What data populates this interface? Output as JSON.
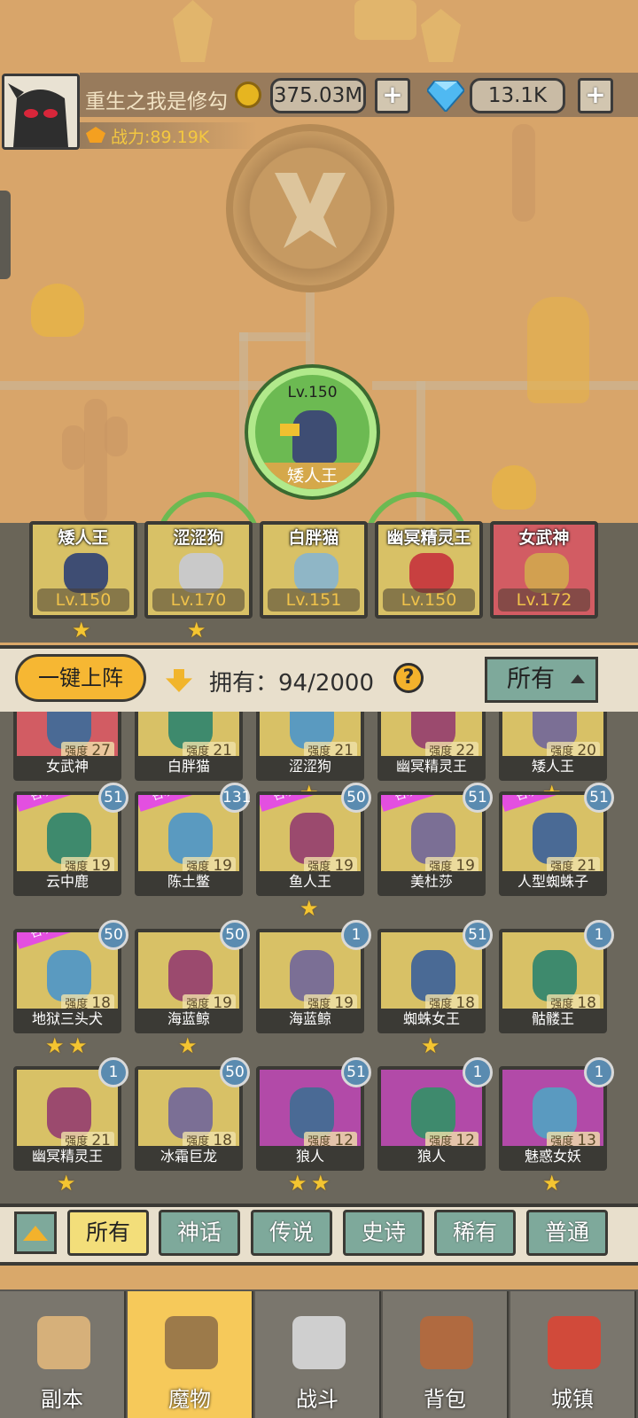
{
  "player": {
    "name": "重生之我是修勾",
    "power_label": "战力:89.19K"
  },
  "currency": {
    "gold": "375.03M",
    "diamond": "13.1K",
    "plus": "+"
  },
  "boss": {
    "level": "Lv.150",
    "name": "矮人王"
  },
  "team": [
    {
      "name": "矮人王",
      "level": "Lv.150",
      "color": "#d8c166",
      "stars": 1
    },
    {
      "name": "涩涩狗",
      "level": "Lv.170",
      "color": "#d8c166",
      "stars": 1
    },
    {
      "name": "白胖猫",
      "level": "Lv.151",
      "color": "#d8c166",
      "stars": 0
    },
    {
      "name": "幽冥精灵王",
      "level": "Lv.150",
      "color": "#d8c166",
      "stars": 0
    },
    {
      "name": "女武神",
      "level": "Lv.172",
      "color": "#d25c63",
      "stars": 0
    }
  ],
  "controls": {
    "auto_deploy": "一键上阵",
    "own_label": "拥有：94/2000",
    "help": "?",
    "filter": "所有"
  },
  "strength_label": "强度",
  "summoning_label": "召唤中",
  "cards_row0": [
    {
      "name": "女武神",
      "strength": "27"
    },
    {
      "name": "白胖猫",
      "strength": "21"
    },
    {
      "name": "涩涩狗",
      "strength": "21"
    },
    {
      "name": "幽冥精灵王",
      "strength": "22"
    },
    {
      "name": "矮人王",
      "strength": "20"
    }
  ],
  "cards_row1": [
    {
      "name": "云中鹿",
      "strength": "19",
      "badge": "51"
    },
    {
      "name": "陈土鳖",
      "strength": "19",
      "badge": "131"
    },
    {
      "name": "鱼人王",
      "strength": "19",
      "badge": "50"
    },
    {
      "name": "美杜莎",
      "strength": "19",
      "badge": "51"
    },
    {
      "name": "人型蜘蛛子",
      "strength": "21",
      "badge": "51"
    }
  ],
  "cards_row2": [
    {
      "name": "地狱三头犬",
      "strength": "18",
      "badge": "50"
    },
    {
      "name": "海蓝鲸",
      "strength": "19",
      "badge": "50"
    },
    {
      "name": "海蓝鲸",
      "strength": "19",
      "badge": "1"
    },
    {
      "name": "蜘蛛女王",
      "strength": "18",
      "badge": "51"
    },
    {
      "name": "骷髅王",
      "strength": "18",
      "badge": "1"
    }
  ],
  "cards_row3": [
    {
      "name": "幽冥精灵王",
      "strength": "21",
      "badge": "1"
    },
    {
      "name": "冰霜巨龙",
      "strength": "18",
      "badge": "50"
    },
    {
      "name": "狼人",
      "strength": "12",
      "badge": "51"
    },
    {
      "name": "狼人",
      "strength": "12",
      "badge": "1"
    },
    {
      "name": "魅惑女妖",
      "strength": "13",
      "badge": "1"
    }
  ],
  "rarity_tabs": [
    "所有",
    "神话",
    "传说",
    "史诗",
    "稀有",
    "普通"
  ],
  "nav": [
    "副本",
    "魔物",
    "战斗",
    "背包",
    "城镇"
  ],
  "colors": {
    "accent_yellow": "#f6b733",
    "card_gold": "#d8c166",
    "card_purple": "#b24aa8",
    "card_red": "#d25c63",
    "tab_teal": "#7ea99b"
  }
}
